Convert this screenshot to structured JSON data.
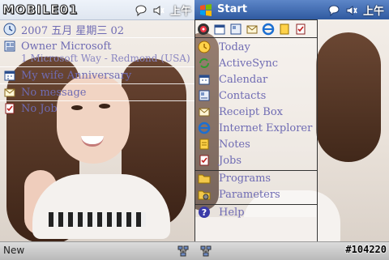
{
  "left_screen": {
    "logo_text": "MOBILE01",
    "time": "上午",
    "date": "2007 五月 星期三 02",
    "owner_name": "Owner Microsoft",
    "owner_address": "1 Microsoft Way - Redmond (USA)",
    "appointment": "My wife Anniversary",
    "messages": "No message",
    "tasks": "No Job",
    "softkey_left": "New"
  },
  "right_screen": {
    "start_label": "Start",
    "time": "上午",
    "menu": [
      {
        "label": "Today",
        "icon": "today-icon"
      },
      {
        "label": "ActiveSync",
        "icon": "activesync-icon"
      },
      {
        "label": "Calendar",
        "icon": "calendar-icon"
      },
      {
        "label": "Contacts",
        "icon": "contacts-icon"
      },
      {
        "label": "Receipt Box",
        "icon": "receipt-box-icon"
      },
      {
        "label": "Internet Explorer",
        "icon": "internet-explorer-icon"
      },
      {
        "label": "Notes",
        "icon": "notes-icon"
      },
      {
        "label": "Jobs",
        "icon": "jobs-icon"
      },
      {
        "label": "Programs",
        "icon": "programs-folder-icon"
      },
      {
        "label": "Parameters",
        "icon": "parameters-folder-icon"
      },
      {
        "label": "Help",
        "icon": "help-icon"
      }
    ],
    "watermark": "#104220"
  },
  "colors": {
    "menu_text": "#6f6bb3",
    "start_bar": "#2f5aa0"
  }
}
